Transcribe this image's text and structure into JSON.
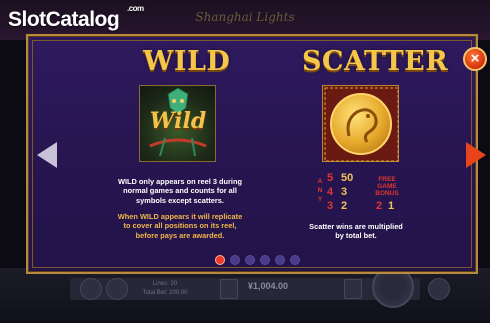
{
  "background": {
    "game_title": "Shanghai Lights",
    "info_lines": [
      "Lines: 20",
      "Total Bet: 200.00"
    ],
    "balance": "¥1,004.00"
  },
  "watermark": {
    "brand_slot": "Slot",
    "brand_catalog": "Catalog",
    "domain": ".com"
  },
  "paytable": {
    "wild": {
      "heading": "WILD",
      "symbol_text": "Wild",
      "description_1": [
        "WILD only appears on reel 3 during",
        "normal games and counts for all",
        "symbols except scatters."
      ],
      "description_2": [
        "When WILD appears it will replicate",
        "to cover all positions on its reel,",
        "before pays are awarded."
      ]
    },
    "scatter": {
      "heading": "SCATTER",
      "any_label": [
        "A",
        "N",
        "Y"
      ],
      "payouts": [
        {
          "count": "5",
          "pay": "50",
          "bonus": "2"
        },
        {
          "count": "4",
          "pay": "3",
          "bonus": ""
        },
        {
          "count": "3",
          "pay": "2",
          "bonus": "1"
        }
      ],
      "bonus_label": [
        "FREE",
        "GAME",
        "BONUS"
      ],
      "description": [
        "Scatter wins are multiplied",
        "by total bet."
      ]
    },
    "close_icon": "×",
    "pagination": {
      "pages": 6,
      "active": 1
    }
  },
  "colors": {
    "panel": "#2a1756",
    "gold": "#f6c64a",
    "red_accent": "#e0352e",
    "border": "#b88a3e"
  }
}
